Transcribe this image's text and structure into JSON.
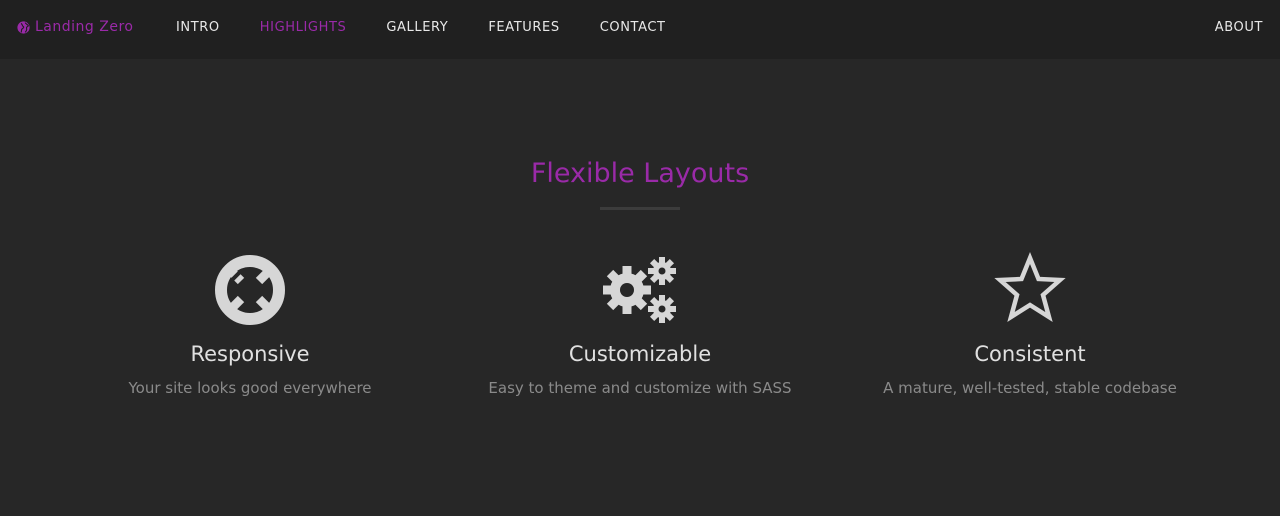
{
  "navbar": {
    "brand": "Landing Zero",
    "links": [
      {
        "label": "INTRO",
        "active": false
      },
      {
        "label": "HIGHLIGHTS",
        "active": true
      },
      {
        "label": "GALLERY",
        "active": false
      },
      {
        "label": "FEATURES",
        "active": false
      },
      {
        "label": "CONTACT",
        "active": false
      }
    ],
    "about": "ABOUT"
  },
  "section": {
    "title": "Flexible Layouts",
    "features": [
      {
        "icon": "life-ring-icon",
        "title": "Responsive",
        "description": "Your site looks good everywhere"
      },
      {
        "icon": "gears-icon",
        "title": "Customizable",
        "description": "Easy to theme and customize with SASS"
      },
      {
        "icon": "star-icon",
        "title": "Consistent",
        "description": "A mature, well-tested, stable codebase"
      }
    ]
  },
  "colors": {
    "accent": "#9a2aa8",
    "background": "#272727",
    "navbar": "#202020",
    "icon": "#d6d6d6"
  }
}
